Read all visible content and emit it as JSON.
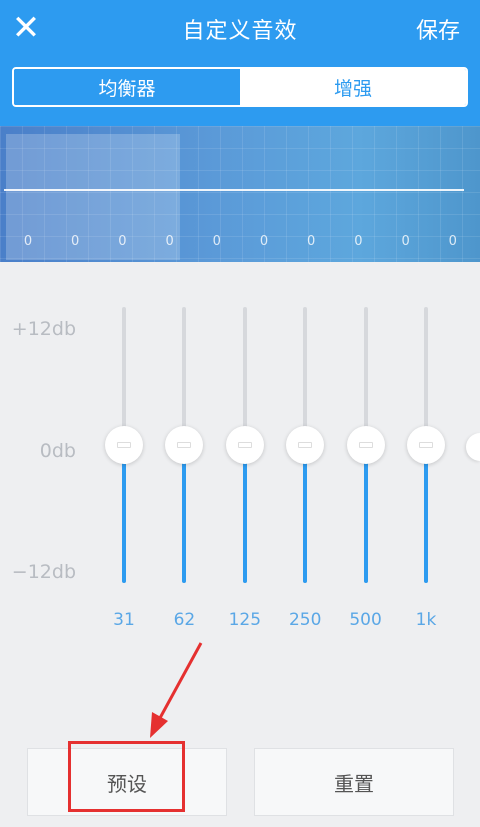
{
  "header": {
    "close_icon": "close-icon",
    "title": "自定义音效",
    "save_label": "保存"
  },
  "tabs": [
    {
      "label": "均衡器",
      "active": true
    },
    {
      "label": "增强",
      "active": false
    }
  ],
  "visualizer": {
    "values": [
      "0",
      "0",
      "0",
      "0",
      "0",
      "0",
      "0",
      "0",
      "0",
      "0"
    ]
  },
  "eq": {
    "db_labels": {
      "top": "+12db",
      "mid": "0db",
      "bottom": "−12db"
    },
    "bands": [
      {
        "freq": "31",
        "level_db": 0
      },
      {
        "freq": "62",
        "level_db": 0
      },
      {
        "freq": "125",
        "level_db": 0
      },
      {
        "freq": "250",
        "level_db": 0
      },
      {
        "freq": "500",
        "level_db": 0
      },
      {
        "freq": "1k",
        "level_db": 0
      }
    ]
  },
  "buttons": {
    "preset_label": "预设",
    "reset_label": "重置"
  },
  "colors": {
    "accent": "#2d9bf0",
    "annotation": "#e53030"
  }
}
